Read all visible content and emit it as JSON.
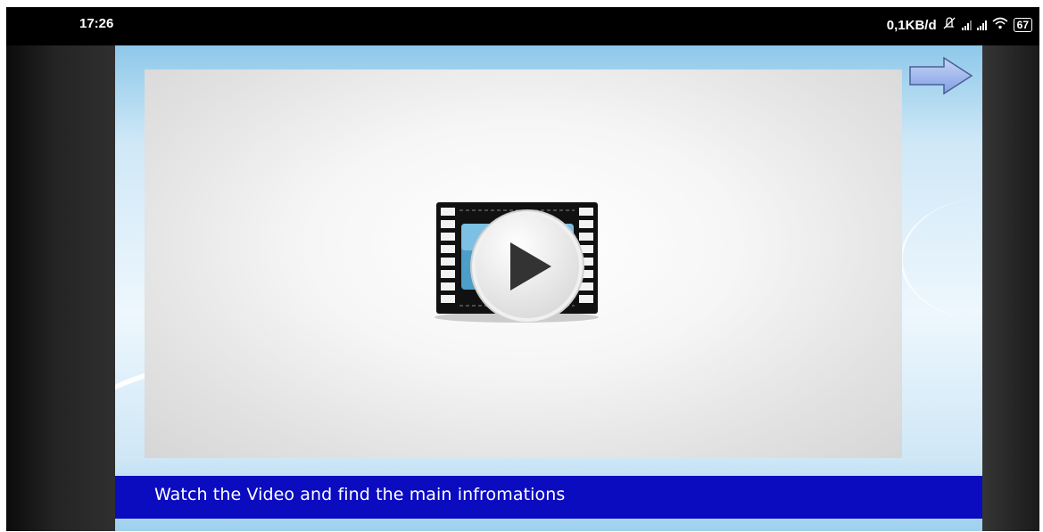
{
  "status_bar": {
    "time": "17:26",
    "network_speed": "0,1KB/d",
    "icons": [
      "mute-icon",
      "signal-icon",
      "signal-icon",
      "wifi-icon"
    ],
    "battery": "67"
  },
  "slide": {
    "video_icon": "video-play-icon",
    "next_icon": "right-arrow-icon",
    "caption": "Watch the Video and find the main infromations",
    "colors": {
      "caption_bar": "#0b0bc0",
      "background": "#cfe8f7",
      "arrow": "#8aa6e6"
    }
  }
}
